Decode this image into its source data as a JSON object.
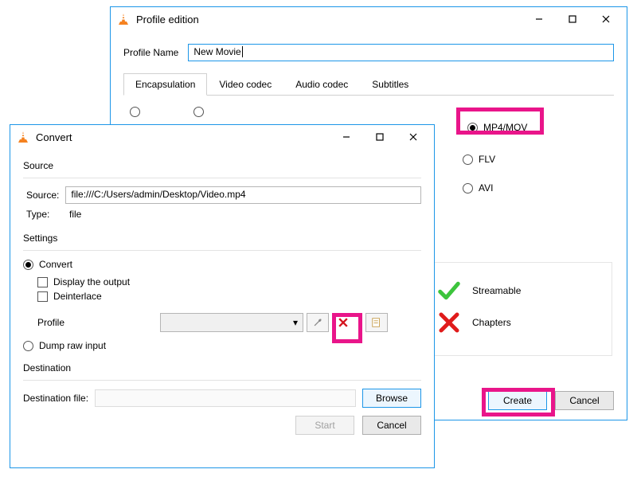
{
  "profile_window": {
    "title": "Profile edition",
    "name_label": "Profile Name",
    "name_value": "New Movie",
    "tabs": {
      "encapsulation": "Encapsulation",
      "video_codec": "Video codec",
      "audio_codec": "Audio codec",
      "subtitles": "Subtitles"
    },
    "formats": {
      "mp4_mov": "MP4/MOV",
      "flv": "FLV",
      "avi": "AVI"
    },
    "features": {
      "streamable": "Streamable",
      "chapters": "Chapters"
    },
    "buttons": {
      "create": "Create",
      "cancel": "Cancel"
    }
  },
  "convert_window": {
    "title": "Convert",
    "source_group": "Source",
    "source_label": "Source:",
    "source_value": "file:///C:/Users/admin/Desktop/Video.mp4",
    "type_label": "Type:",
    "type_value": "file",
    "settings_group": "Settings",
    "convert_radio": "Convert",
    "display_output": "Display the output",
    "deinterlace": "Deinterlace",
    "profile_label": "Profile",
    "dump_raw": "Dump raw input",
    "destination_group": "Destination",
    "destination_label": "Destination file:",
    "buttons": {
      "browse": "Browse",
      "start": "Start",
      "cancel": "Cancel"
    }
  },
  "icons": {
    "vlc": "vlc-cone",
    "wrench": "wrench-icon",
    "delete_x": "delete-icon",
    "new_profile": "new-profile-icon",
    "dropdown": "▾",
    "check_green": "checkmark",
    "x_red": "x-mark"
  },
  "colors": {
    "highlight": "#e9158a",
    "window_border": "#1c96e8",
    "green": "#3cc43c",
    "red": "#e01b1b"
  }
}
